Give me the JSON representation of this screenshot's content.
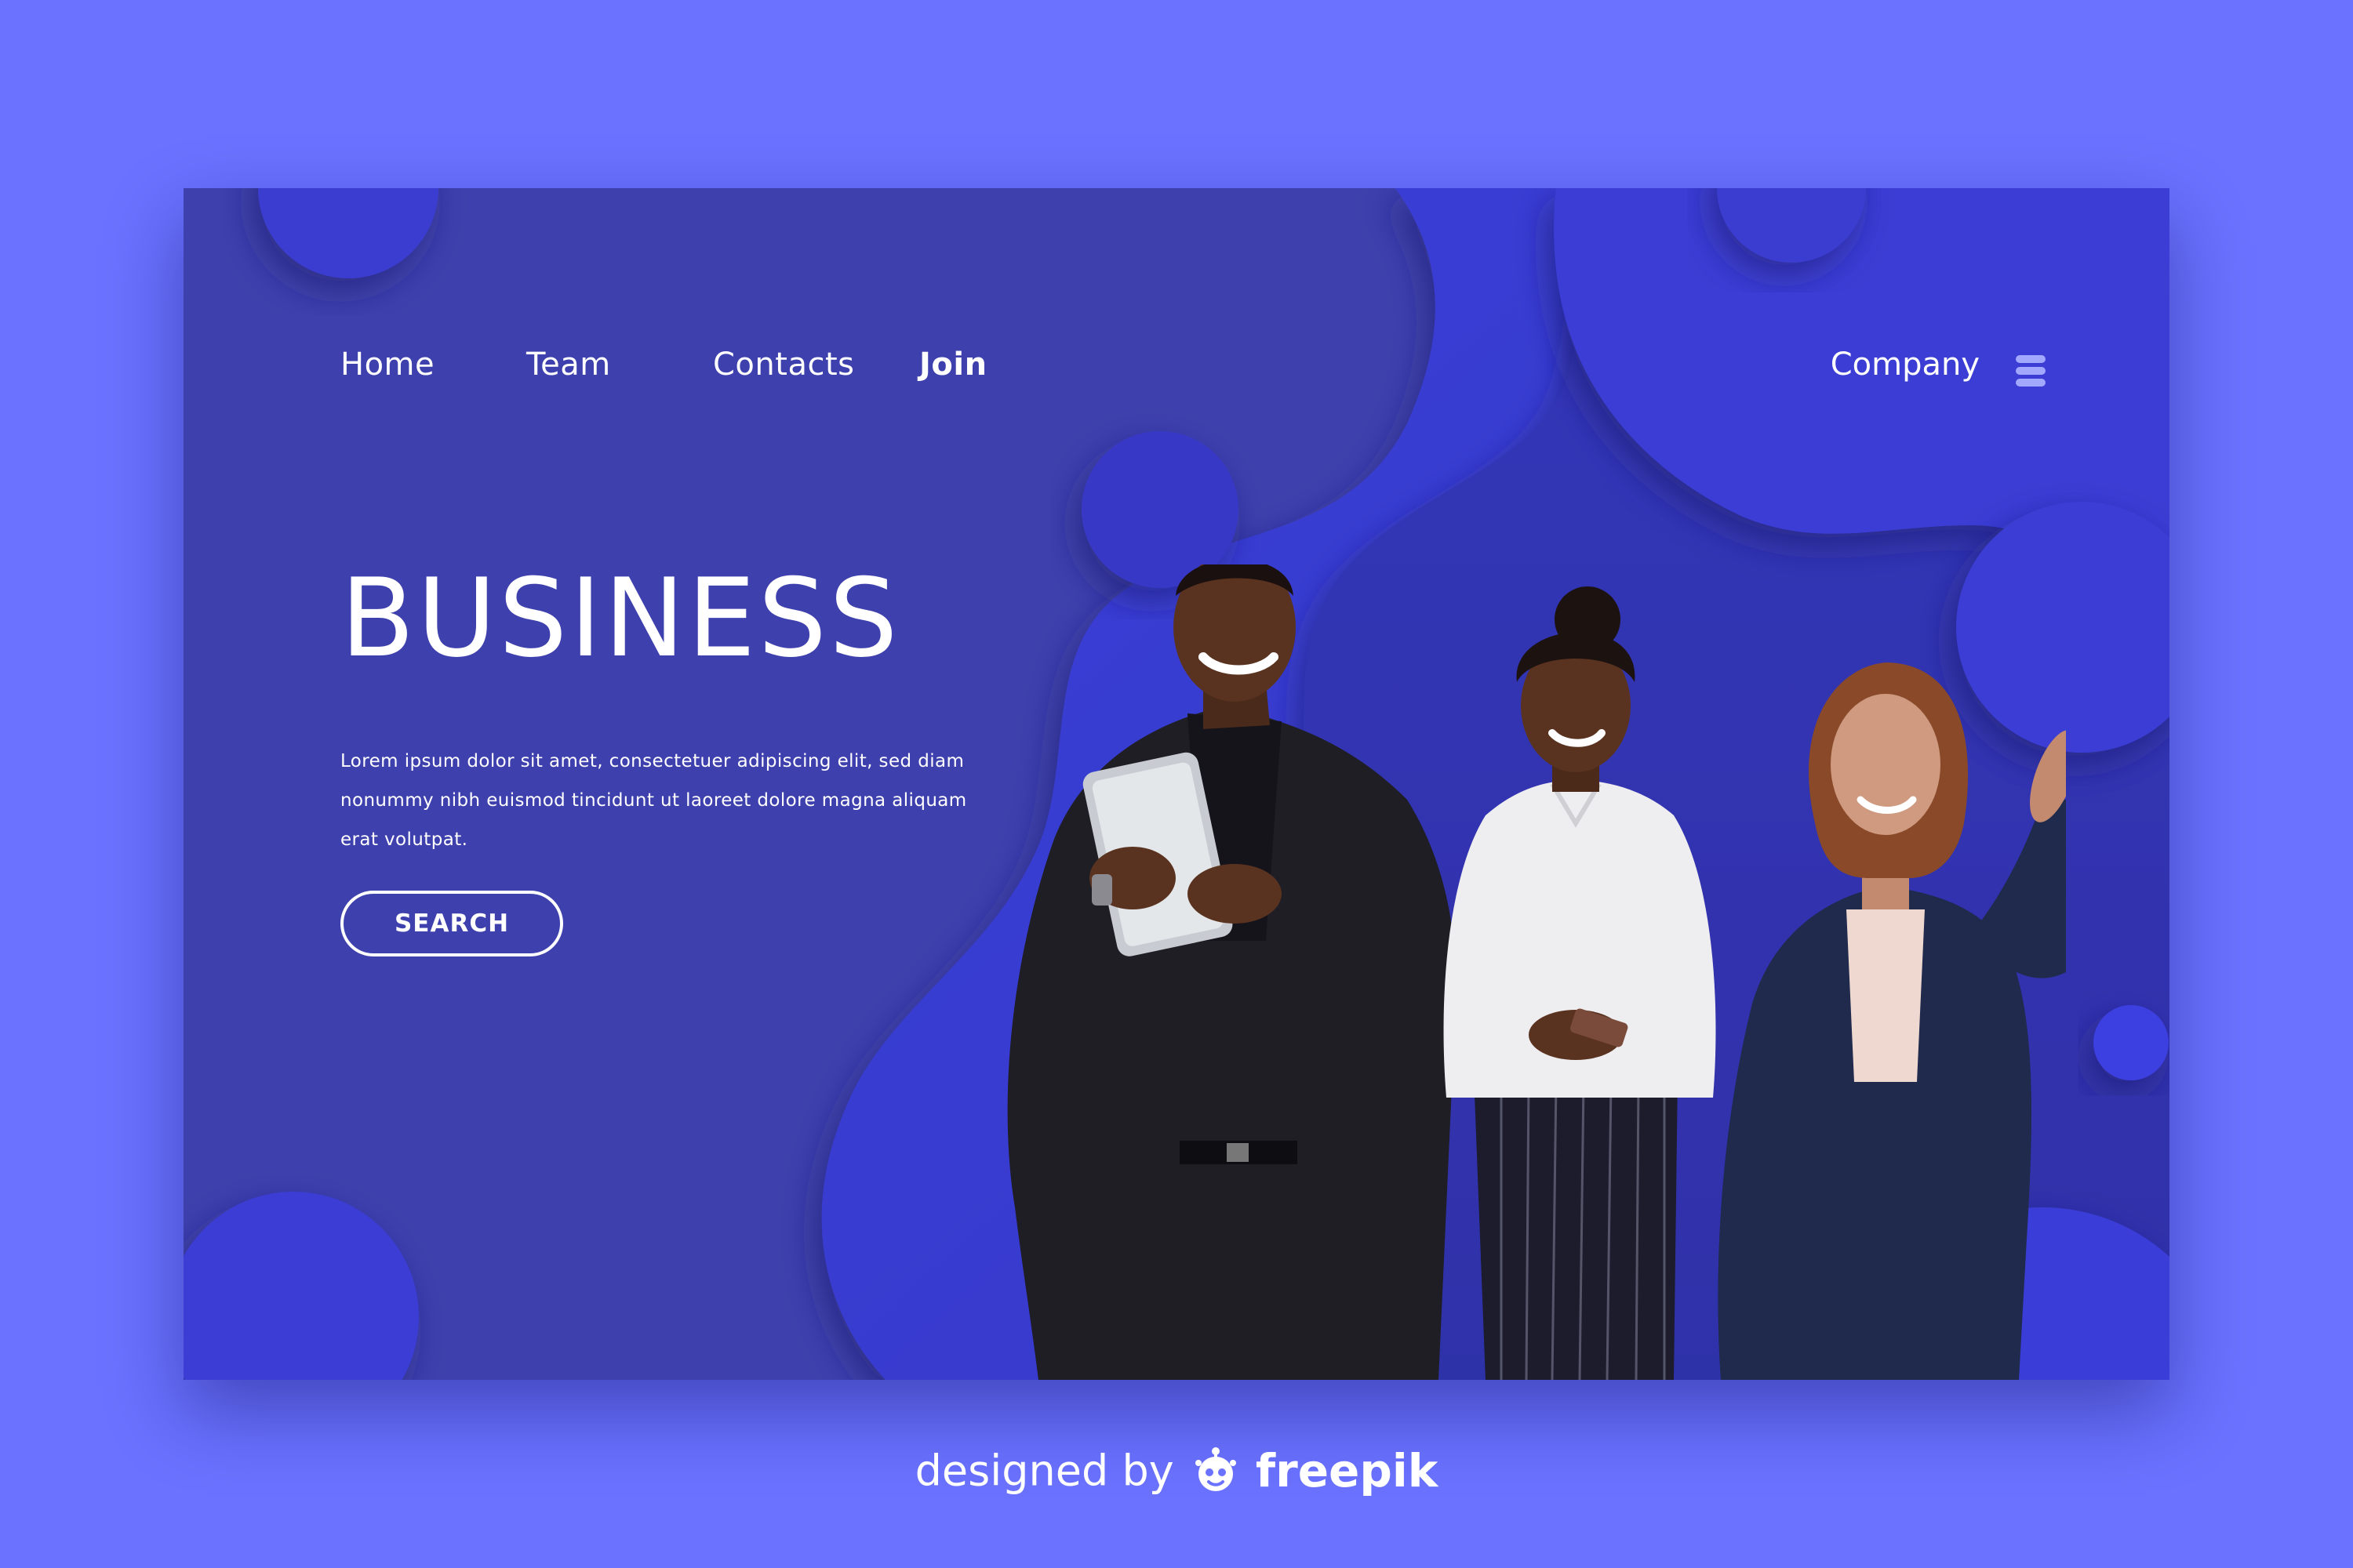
{
  "nav": {
    "home": "Home",
    "team": "Team",
    "contacts": "Contacts",
    "join": "Join",
    "company": "Company",
    "menu_icon": "hamburger-menu-icon"
  },
  "hero": {
    "title": "BUSINESS",
    "body": "Lorem ipsum dolor sit amet, consectetuer adipiscing elit, sed diam nonummy nibh euismod tincidunt ut laoreet dolore magna aliquam erat volutpat.",
    "button_label": "SEARCH"
  },
  "credit": {
    "designed_by": "designed by",
    "brand": "freepik",
    "logo_icon": "freepik-logo-icon"
  },
  "colors": {
    "page_background": "#6a72ff",
    "card_background": "#3e40ad",
    "wave_light": "#3d3fd6",
    "accent_menu": "#a2a7ff",
    "text": "#ffffff"
  }
}
